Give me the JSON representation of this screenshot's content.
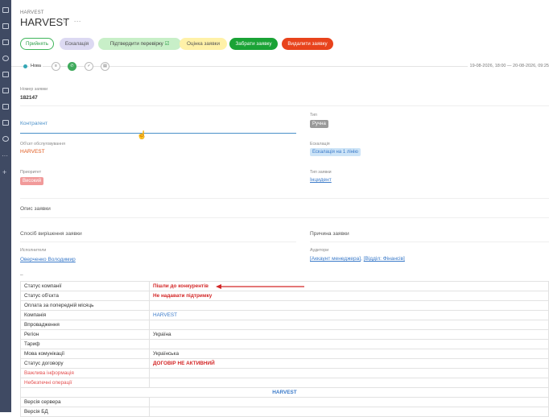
{
  "header": {
    "breadcrumb": "HARVEST",
    "title": "HARVEST",
    "star": "☆",
    "more": "···"
  },
  "actions": [
    {
      "label": "Прийнять",
      "bg": "#ffffff",
      "border": "#3fb55a",
      "color": "#2c9e48"
    },
    {
      "label": "Ескалація",
      "bg": "#dcd9f2",
      "border": "#dcd9f2",
      "color": "#555"
    },
    {
      "label": "Підтвердити перевірку",
      "check": "☑",
      "bg": "#c8efc8",
      "border": "#c8efc8",
      "color": "#444"
    },
    {
      "label": "Оцінка заявки",
      "bg": "#fff1a8",
      "border": "#fff1a8",
      "color": "#555"
    },
    {
      "label": "Забрати заявку",
      "bg": "#1aa336",
      "border": "#1aa336",
      "color": "#ffffff"
    },
    {
      "label": "Видалити заявку",
      "bg": "#e8431c",
      "border": "#e8431c",
      "color": "#ffffff"
    }
  ],
  "status": {
    "label": "Нова",
    "color": "#34a7b5"
  },
  "dates": "19-08-2026, 18:00 — 20-08-2026, 09:25",
  "form": {
    "number_label": "Номер заявки",
    "number": "182147",
    "counterparty_label": "Контрагент",
    "object_label": "Об'єкт обслуговування",
    "object": "HARVEST",
    "priority_label": "Приоритет",
    "priority": "Високий",
    "type_label": "Тип",
    "type": "Ручна",
    "escalation_label": "Ескалація",
    "escalation": "Ескалація на 1 лінію",
    "request_type_label": "Тип заявки",
    "request_type": "Інцидент",
    "description_label": "Опис заявки",
    "solution_label": "Спосіб вирішення заявки",
    "reason_label": "Причина заявки",
    "executors_label": "Исполнители",
    "executor": "Оверченко Володимир",
    "auditors_label": "Аудитори",
    "auditor1": "[Аккаунт менеджера]",
    "auditor_sep": ",",
    "auditor2": "[Відділ: Фінансів]",
    "dash": "–"
  },
  "table": [
    {
      "label": "Статус компанії",
      "value": "Пішли до конкурентів",
      "style": "red"
    },
    {
      "label": "Статус об'єкта",
      "value": "Не надавати підтримку",
      "style": "red"
    },
    {
      "label": "Оплата за попередній місяць",
      "value": ""
    },
    {
      "label": "Компанія",
      "value": "HARVEST",
      "style": "blue"
    },
    {
      "label": "Впровадження",
      "value": ""
    },
    {
      "label": "Регіон",
      "value": "Україна"
    },
    {
      "label": "Тариф",
      "value": ""
    },
    {
      "label": "Мова комунікації",
      "value": "Українська"
    },
    {
      "label": "Статус договору",
      "value": "ДОГОВІР НЕ АКТИВНИЙ",
      "style": "red"
    },
    {
      "label": "Важлива інформація",
      "value": "",
      "labelStyle": "redlbl"
    },
    {
      "label": "Небезпечні операції",
      "value": "",
      "labelStyle": "redlbl"
    },
    {
      "header": "HARVEST"
    },
    {
      "label": "Версія сервера",
      "value": ""
    },
    {
      "label": "Версія БД",
      "value": ""
    }
  ]
}
